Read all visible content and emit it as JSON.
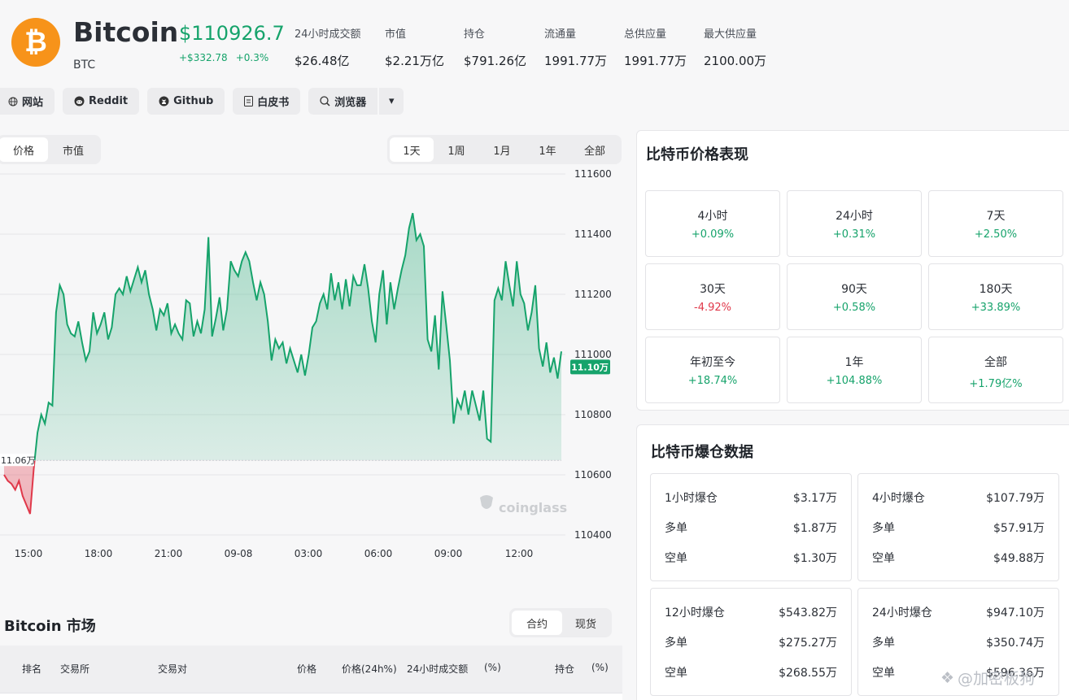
{
  "coin": {
    "logo_glyph": "₿",
    "name": "Bitcoin",
    "symbol": "BTC",
    "price": "$110926.7",
    "change_abs": "+$332.78",
    "change_pct": "+0.3%"
  },
  "stats": [
    {
      "label": "24小时成交额",
      "value": "$26.48亿"
    },
    {
      "label": "市值",
      "value": "$2.21万亿"
    },
    {
      "label": "持仓",
      "value": "$791.26亿"
    },
    {
      "label": "流通量",
      "value": "1991.77万"
    },
    {
      "label": "总供应量",
      "value": "1991.77万"
    },
    {
      "label": "最大供应量",
      "value": "2100.00万"
    }
  ],
  "links": {
    "website": "网站",
    "reddit": "Reddit",
    "github": "Github",
    "whitepaper": "白皮书",
    "explorer": "浏览器",
    "dropdown": "▾"
  },
  "chart_tabs": {
    "price": "价格",
    "market_cap": "市值"
  },
  "range_tabs": [
    "1天",
    "1周",
    "1月",
    "1年",
    "全部"
  ],
  "chart_data": {
    "type": "area",
    "x_ticks": [
      "15:00",
      "18:00",
      "21:00",
      "09-08",
      "03:00",
      "06:00",
      "09:00",
      "12:00"
    ],
    "y_ticks": [
      "111600",
      "111400",
      "111200",
      "111000",
      "110800",
      "110600",
      "110400"
    ],
    "ylim": [
      110400,
      111600
    ],
    "baseline_label": "11.06万",
    "baseline": 110648,
    "current_label": "11.10万",
    "current": 110980,
    "grid": true,
    "watermark": "coinglass",
    "values": [
      110600,
      110580,
      110570,
      110550,
      110580,
      110530,
      110500,
      110470,
      110620,
      110740,
      110800,
      110770,
      110840,
      110830,
      111140,
      111230,
      111200,
      111100,
      111070,
      111060,
      111110,
      111040,
      110980,
      111010,
      111140,
      111070,
      111100,
      111140,
      111050,
      111090,
      111200,
      111220,
      111200,
      111260,
      111210,
      111250,
      111290,
      111240,
      111280,
      111200,
      111150,
      111080,
      111150,
      111130,
      111170,
      111070,
      111100,
      111070,
      111050,
      111180,
      111170,
      111060,
      111110,
      111070,
      111150,
      111390,
      111060,
      111120,
      111190,
      111080,
      111150,
      111310,
      111280,
      111260,
      111310,
      111340,
      111310,
      111240,
      111180,
      111240,
      111200,
      111110,
      110980,
      111050,
      111020,
      111040,
      110970,
      111020,
      110980,
      110940,
      111000,
      110930,
      111000,
      111090,
      111110,
      111170,
      111200,
      111150,
      111270,
      111180,
      111240,
      111150,
      111250,
      111160,
      111260,
      111230,
      111230,
      111300,
      111220,
      111110,
      111040,
      111200,
      111280,
      111100,
      111240,
      111150,
      111220,
      111280,
      111330,
      111420,
      111470,
      111380,
      111400,
      111360,
      111050,
      111010,
      111130,
      110950,
      111210,
      111100,
      110980,
      110770,
      110850,
      110820,
      110880,
      110800,
      110880,
      110830,
      110780,
      110880,
      110720,
      110710,
      111180,
      111220,
      111180,
      111310,
      111230,
      111160,
      111310,
      111200,
      111170,
      111080,
      111140,
      111230,
      111020,
      110960,
      111040,
      110940,
      110990,
      110920,
      111010
    ]
  },
  "perf": {
    "title": "比特币价格表现",
    "items": [
      {
        "label": "4小时",
        "value": "+0.09%",
        "dir": "up"
      },
      {
        "label": "24小时",
        "value": "+0.31%",
        "dir": "up"
      },
      {
        "label": "7天",
        "value": "+2.50%",
        "dir": "up"
      },
      {
        "label": "30天",
        "value": "-4.92%",
        "dir": "down"
      },
      {
        "label": "90天",
        "value": "+0.58%",
        "dir": "up"
      },
      {
        "label": "180天",
        "value": "+33.89%",
        "dir": "up"
      },
      {
        "label": "年初至今",
        "value": "+18.74%",
        "dir": "up"
      },
      {
        "label": "1年",
        "value": "+104.88%",
        "dir": "up"
      },
      {
        "label": "全部",
        "value": "+1.79亿%",
        "dir": "up"
      }
    ]
  },
  "liq": {
    "title": "比特币爆仓数据",
    "long_label": "多单",
    "short_label": "空单",
    "cards": [
      {
        "label": "1小时爆仓",
        "total": "$3.17万",
        "long": "$1.87万",
        "short": "$1.30万"
      },
      {
        "label": "4小时爆仓",
        "total": "$107.79万",
        "long": "$57.91万",
        "short": "$49.88万"
      },
      {
        "label": "12小时爆仓",
        "total": "$543.82万",
        "long": "$275.27万",
        "short": "$268.55万"
      },
      {
        "label": "24小时爆仓",
        "total": "$947.10万",
        "long": "$350.74万",
        "short": "$596.36万"
      }
    ]
  },
  "market": {
    "title": "Bitcoin 市场",
    "tabs": [
      "合约",
      "现货"
    ],
    "columns": [
      "排名",
      "交易所",
      "交易对",
      "价格",
      "价格(24h%)",
      "24小时成交额",
      "(%)",
      "持仓",
      "(%)"
    ]
  },
  "watermark": "@加密板狗",
  "colors": {
    "up": "#16a36b",
    "down": "#e0384a",
    "btc": "#f7931a"
  }
}
